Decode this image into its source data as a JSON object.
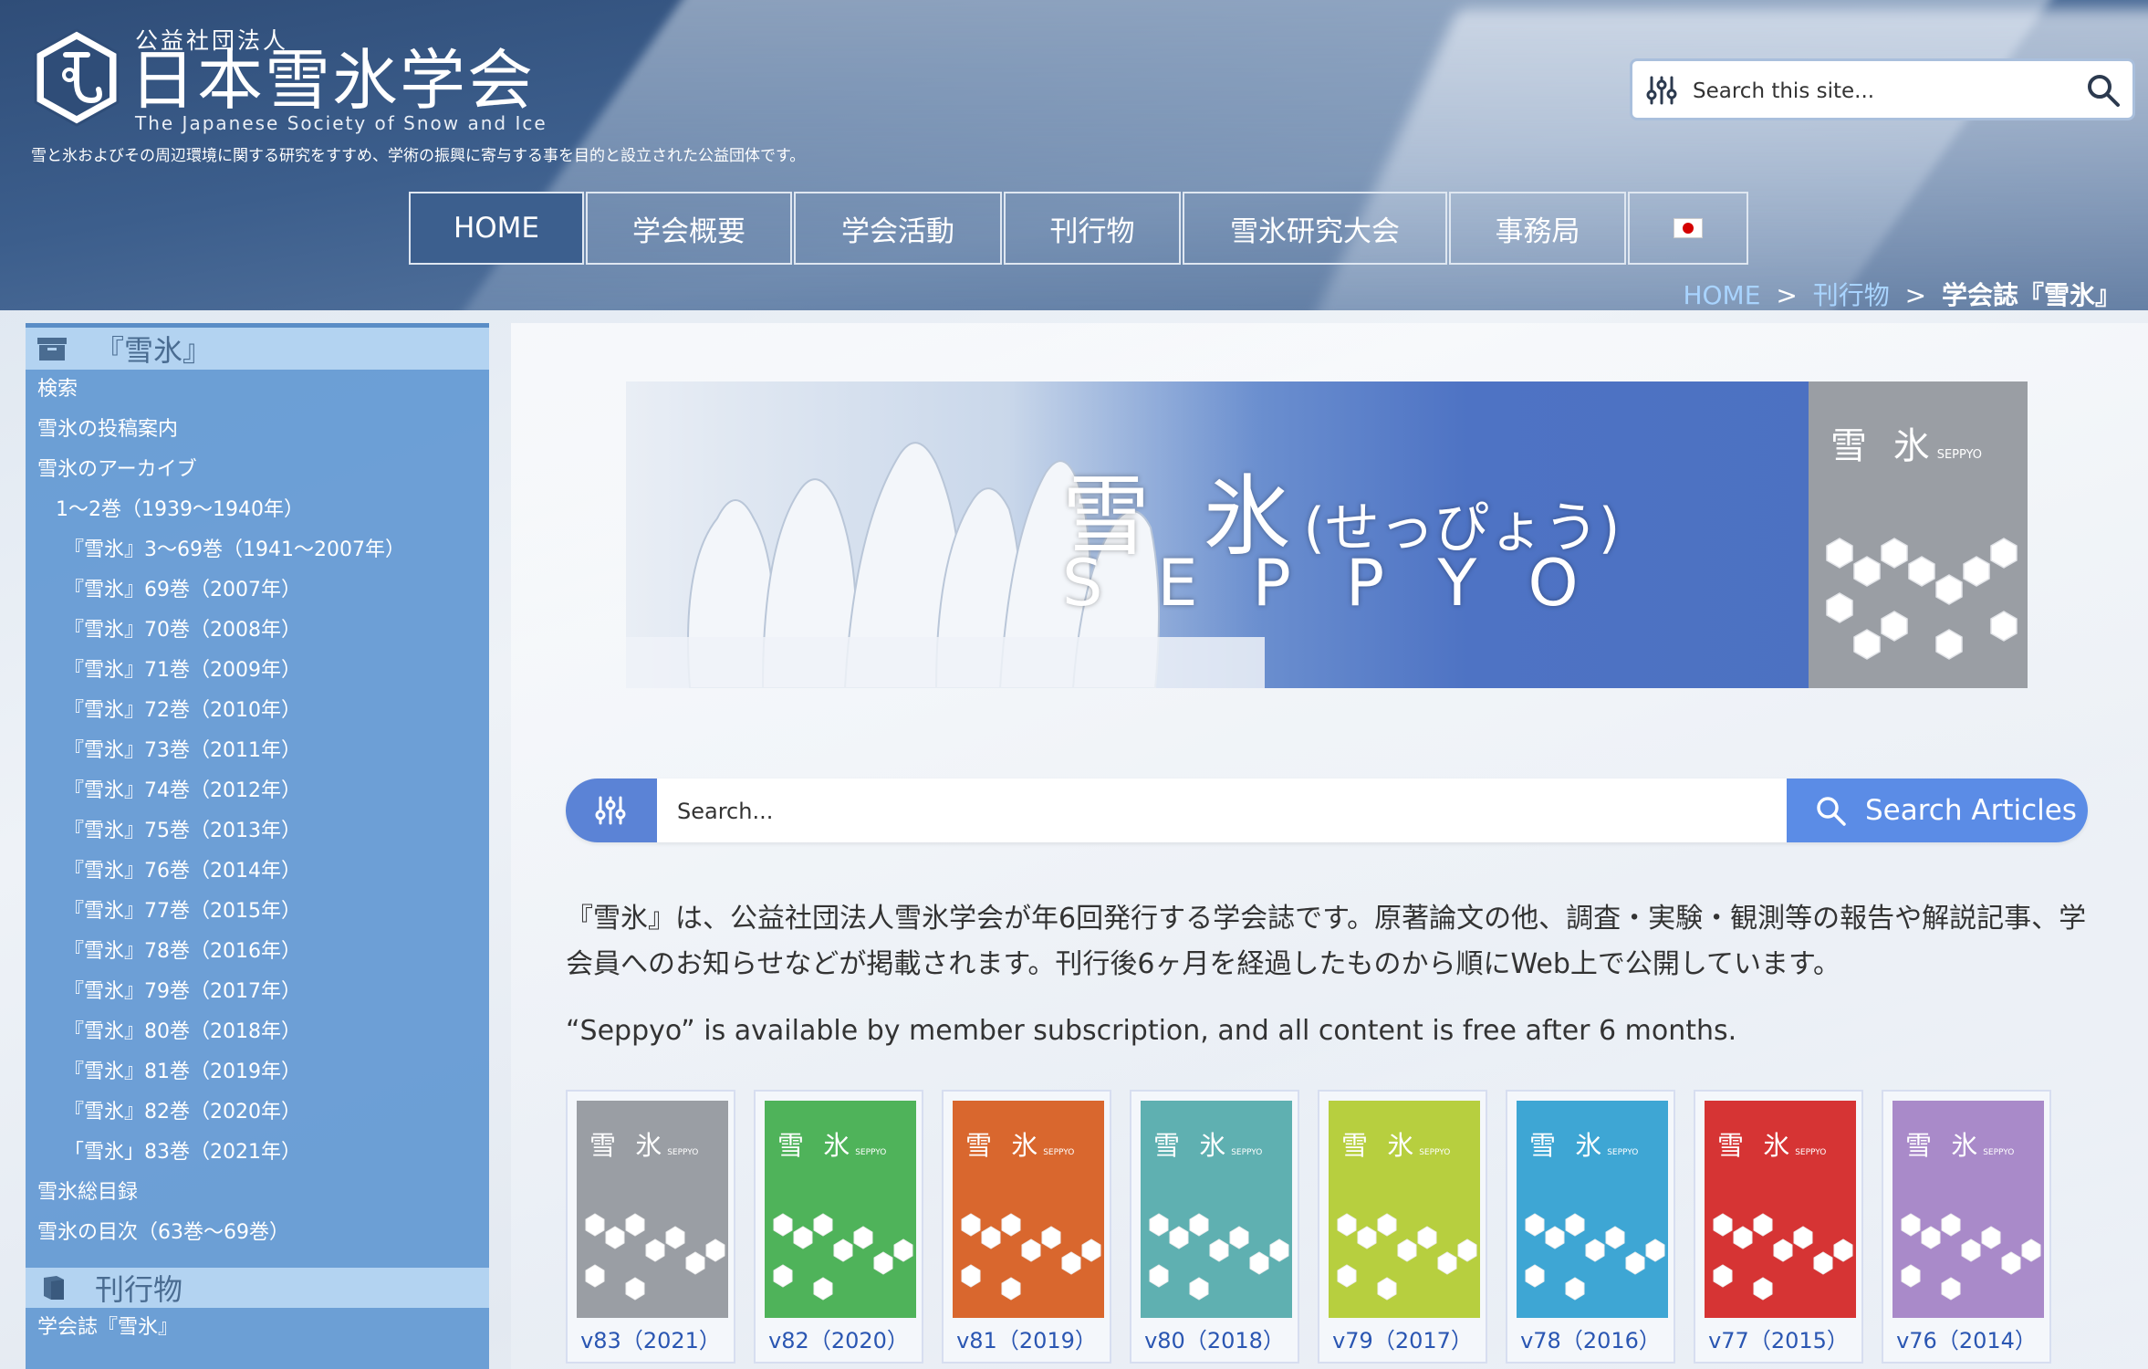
{
  "header": {
    "org_type": "公益社団法人",
    "org_name": "日本雪氷学会",
    "org_en": "The Japanese Society of Snow and Ice",
    "tagline": "雪と氷およびその周辺環境に関する研究をすすめ、学術の振興に寄与する事を目的と設立された公益団体です。",
    "search_placeholder": "Search this site..."
  },
  "nav": {
    "items": [
      {
        "label": "HOME"
      },
      {
        "label": "学会概要"
      },
      {
        "label": "学会活動"
      },
      {
        "label": "刊行物"
      },
      {
        "label": "雪氷研究大会"
      },
      {
        "label": "事務局"
      }
    ],
    "lang_icon": "japan-flag-icon"
  },
  "breadcrumb": {
    "home": "HOME",
    "sep": ">",
    "section": "刊行物",
    "current": "学会誌『雪氷』"
  },
  "sidebar": {
    "heading": "『雪氷』",
    "items": [
      {
        "label": "検索"
      },
      {
        "label": "雪氷の投稿案内"
      },
      {
        "label": "雪氷のアーカイブ"
      },
      {
        "label": "1〜2巻（1939〜1940年）"
      },
      {
        "label": "『雪氷』3〜69巻（1941〜2007年）"
      },
      {
        "label": "『雪氷』69巻（2007年）"
      },
      {
        "label": "『雪氷』70巻（2008年）"
      },
      {
        "label": "『雪氷』71巻（2009年）"
      },
      {
        "label": "『雪氷』72巻（2010年）"
      },
      {
        "label": "『雪氷』73巻（2011年）"
      },
      {
        "label": "『雪氷』74巻（2012年）"
      },
      {
        "label": "『雪氷』75巻（2013年）"
      },
      {
        "label": "『雪氷』76巻（2014年）"
      },
      {
        "label": "『雪氷』77巻（2015年）"
      },
      {
        "label": "『雪氷』78巻（2016年）"
      },
      {
        "label": "『雪氷』79巻（2017年）"
      },
      {
        "label": "『雪氷』80巻（2018年）"
      },
      {
        "label": "『雪氷』81巻（2019年）"
      },
      {
        "label": "『雪氷』82巻（2020年）"
      },
      {
        "label": "「雪氷」83巻（2021年）"
      },
      {
        "label": "雪氷総目録"
      },
      {
        "label": "雪氷の目次（63巻〜69巻）"
      }
    ],
    "heading2": "刊行物",
    "items2": [
      {
        "label": "学会誌『雪氷』"
      }
    ]
  },
  "banner": {
    "title": "雪 氷",
    "title_kana": "(せっぴょう)",
    "subtitle": "SEPPYO",
    "cover_title": "雪 氷",
    "cover_sub": "SEPPYO"
  },
  "article_search": {
    "placeholder": "Search...",
    "button": "Search Articles"
  },
  "description": {
    "jp": "『雪氷』は、公益社団法人雪氷学会が年6回発行する学会誌です。原著論文の他、調査・実験・観測等の報告や解説記事、学会員へのお知らせなどが掲載されます。刊行後6ヶ月を経過したものから順にWeb上で公開しています。",
    "en": "“Seppyo” is available by member subscription, and all content is free after 6 months."
  },
  "covers": {
    "cover_title": "雪 氷",
    "cover_sub": "SEPPYO",
    "items": [
      {
        "label": "v83（2021）",
        "color": "#9a9ea4"
      },
      {
        "label": "v82（2020）",
        "color": "#4fb35a"
      },
      {
        "label": "v81（2019）",
        "color": "#d9672e"
      },
      {
        "label": "v80（2018）",
        "color": "#5fb0b1"
      },
      {
        "label": "v79（2017）",
        "color": "#b7cf3f"
      },
      {
        "label": "v78（2016）",
        "color": "#3ea6d4"
      },
      {
        "label": "v77（2015）",
        "color": "#d63434"
      },
      {
        "label": "v76（2014）",
        "color": "#a98ac9"
      }
    ]
  },
  "colors": {
    "sidebar_bg": "#6298d2",
    "accent_blue": "#5b8ce6",
    "link_blue": "#2a56b2"
  }
}
